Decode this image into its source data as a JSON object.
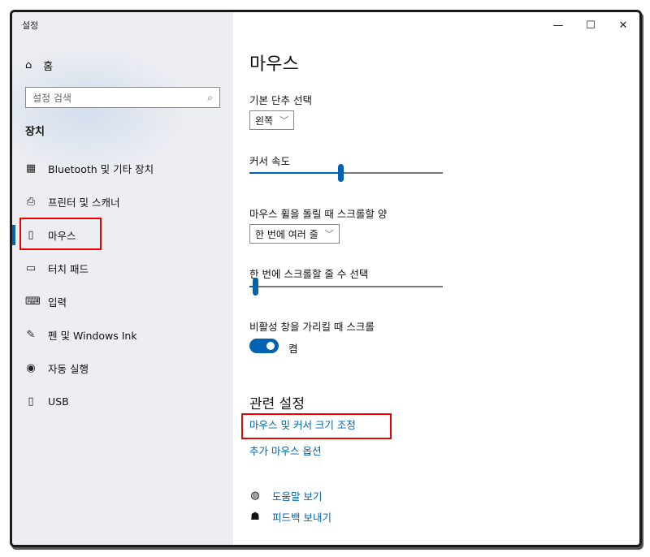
{
  "window": {
    "title": "설정",
    "minimize": "—",
    "maximize": "☐",
    "close": "✕"
  },
  "sidebar": {
    "home_label": "홈",
    "search_placeholder": "설정 검색",
    "section_title": "장치",
    "items": [
      {
        "label": "Bluetooth 및 기타 장치",
        "icon": "bluetooth-devices-icon",
        "glyph": "▦"
      },
      {
        "label": "프린터 및 스캐너",
        "icon": "printer-icon",
        "glyph": "⎙"
      },
      {
        "label": "마우스",
        "icon": "mouse-icon",
        "glyph": "▯"
      },
      {
        "label": "터치 패드",
        "icon": "touchpad-icon",
        "glyph": "▭"
      },
      {
        "label": "입력",
        "icon": "keyboard-icon",
        "glyph": "⌨"
      },
      {
        "label": "펜 및 Windows Ink",
        "icon": "pen-icon",
        "glyph": "✎"
      },
      {
        "label": "자동 실행",
        "icon": "autoplay-icon",
        "glyph": "◉"
      },
      {
        "label": "USB",
        "icon": "usb-icon",
        "glyph": "▯"
      }
    ]
  },
  "main": {
    "title": "마우스",
    "primary_button_label": "기본 단추 선택",
    "primary_button_value": "왼쪽",
    "cursor_speed_label": "커서 속도",
    "cursor_speed_level": 0.47,
    "wheel_label": "마우스 휠을 돌릴 때 스크롤할 양",
    "wheel_value": "한 번에 여러 줄",
    "lines_label": "한 번에 스크롤할 줄 수 선택",
    "lines_level": 0.03,
    "inactive_scroll_label": "비활성 창을 가리킬 때 스크롤",
    "inactive_scroll_state": "켬",
    "related_title": "관련 설정",
    "related_links": [
      "마우스 및 커서 크기 조정",
      "추가 마우스 옵션"
    ],
    "help_link": "도움말 보기",
    "feedback_link": "피드백 보내기"
  },
  "accent_color": "#0063b1",
  "highlight_color": "#e00000"
}
